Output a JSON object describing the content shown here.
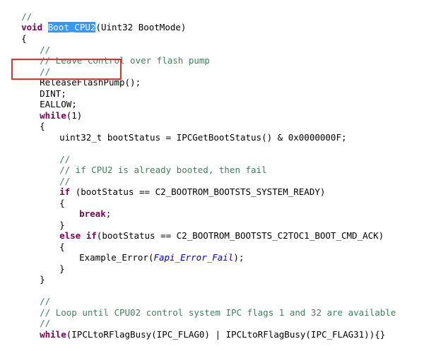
{
  "code": {
    "l01": {
      "c": "//"
    },
    "l02": {
      "kw": "void",
      "sp": " ",
      "fname": "Boot_CPU2",
      "rest": "(Uint32 BootMode)"
    },
    "l03": {
      "t": "{"
    },
    "l04": {
      "c": "//"
    },
    "l05": {
      "c": "// Leave control over flash pump"
    },
    "l06": {
      "c": "//"
    },
    "l07": {
      "t": "ReleaseFlashPump();"
    },
    "l08": {
      "t": "DINT;"
    },
    "l09": {
      "t": "EALLOW;"
    },
    "l10": {
      "kw": "while",
      "rest": "(1)"
    },
    "l11": {
      "t": "{"
    },
    "l12": {
      "t": "uint32_t bootStatus = IPCGetBootStatus() & 0x0000000F;"
    },
    "l14": {
      "c": "//"
    },
    "l15": {
      "c": "// if CPU2 is already booted, then fail"
    },
    "l16": {
      "c": "//"
    },
    "l17": {
      "kw": "if",
      "rest": " (bootStatus == C2_BOOTROM_BOOTSTS_SYSTEM_READY)"
    },
    "l18": {
      "t": "{"
    },
    "l19": {
      "kw": "break",
      "rest": ";"
    },
    "l20": {
      "t": "}"
    },
    "l21": {
      "kw": "else if",
      "rest": "(bootStatus == C2_BOOTROM_BOOTSTS_C2TOC1_BOOT_CMD_ACK)"
    },
    "l22": {
      "t": "{"
    },
    "l23": {
      "pre": "Example_Error(",
      "ital": "Fapi_Error_Fail",
      "post": ");"
    },
    "l24": {
      "t": "}"
    },
    "l25": {
      "t": "}"
    },
    "l27": {
      "c": "//"
    },
    "l28": {
      "c": "// Loop until CPU02 control system IPC flags 1 and 32 are available"
    },
    "l29": {
      "c": "//"
    },
    "l30": {
      "kw": "while",
      "rest": "(IPCLtoRFlagBusy(IPC_FLAG0) | IPCLtoRFlagBusy(IPC_FLAG31)){}"
    }
  },
  "colors": {
    "comment": "#3f7f5f",
    "keyword": "#7f0055",
    "selection": "#3399ff",
    "highlight_box": "#e03030"
  }
}
